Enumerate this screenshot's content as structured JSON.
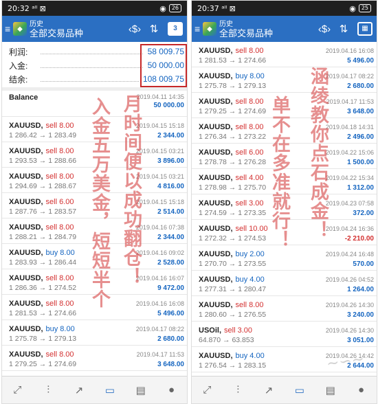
{
  "left": {
    "status": {
      "time": "20:32",
      "signal": "ᵃˡˡ ⊠",
      "battery": "26"
    },
    "header": {
      "title": "历史",
      "subtitle": "全部交易品种",
      "calendar_label": "3"
    },
    "summary": [
      {
        "label": "利润:",
        "value": "58 009.75"
      },
      {
        "label": "入金:",
        "value": "50 000.00"
      },
      {
        "label": "结余:",
        "value": "108 009.75"
      }
    ],
    "balance": {
      "label": "Balance",
      "date": "2019.04.11 14:35",
      "amount": "50 000.00"
    },
    "trades": [
      {
        "symbol": "XAUUSD,",
        "side": "sell 8.00",
        "type": "sell",
        "date": "2019.04.15 15:18",
        "prices": "1 286.42 → 1 283.49",
        "profit": "2 344.00"
      },
      {
        "symbol": "XAUUSD,",
        "side": "sell 8.00",
        "type": "sell",
        "date": "2019.04.15 03:21",
        "prices": "1 293.53 → 1 288.66",
        "profit": "3 896.00"
      },
      {
        "symbol": "XAUUSD,",
        "side": "sell 8.00",
        "type": "sell",
        "date": "2019.04.15 03:21",
        "prices": "1 294.69 → 1 288.67",
        "profit": "4 816.00"
      },
      {
        "symbol": "XAUUSD,",
        "side": "sell 6.00",
        "type": "sell",
        "date": "2019.04.15 15:18",
        "prices": "1 287.76 → 1 283.57",
        "profit": "2 514.00"
      },
      {
        "symbol": "XAUUSD,",
        "side": "sell 8.00",
        "type": "sell",
        "date": "2019.04.16 07:38",
        "prices": "1 288.21 → 1 284.79",
        "profit": "2 344.00"
      },
      {
        "symbol": "XAUUSD,",
        "side": "buy 8.00",
        "type": "buy",
        "date": "2019.04.16 09:02",
        "prices": "1 283.93 → 1 286.44",
        "profit": "2 528.00"
      },
      {
        "symbol": "XAUUSD,",
        "side": "sell 8.00",
        "type": "sell",
        "date": "2019.04.16 16:07",
        "prices": "1 286.36 → 1 274.52",
        "profit": "9 472.00"
      },
      {
        "symbol": "XAUUSD,",
        "side": "sell 8.00",
        "type": "sell",
        "date": "2019.04.16 16:08",
        "prices": "1 281.53 → 1 274.66",
        "profit": "5 496.00"
      },
      {
        "symbol": "XAUUSD,",
        "side": "buy 8.00",
        "type": "buy",
        "date": "2019.04.17 08:22",
        "prices": "1 275.78 → 1 279.13",
        "profit": "2 680.00"
      },
      {
        "symbol": "XAUUSD,",
        "side": "sell 8.00",
        "type": "sell",
        "date": "2019.04.17 11:53",
        "prices": "1 279.25 → 1 274.69",
        "profit": "3 648.00"
      }
    ],
    "overlay_col1": "入金五万美金，短短半个",
    "overlay_col2": "月时间便以成功翻仓！"
  },
  "right": {
    "status": {
      "time": "20:37",
      "signal": "ᵃˡˡ ⊠",
      "battery": "25"
    },
    "header": {
      "title": "历史",
      "subtitle": "全部交易品种"
    },
    "trades": [
      {
        "symbol": "XAUUSD,",
        "side": "sell 8.00",
        "type": "sell",
        "date": "2019.04.16 16:08",
        "prices": "1 281.53 → 1 274.66",
        "profit": "5 496.00"
      },
      {
        "symbol": "XAUUSD,",
        "side": "buy 8.00",
        "type": "buy",
        "date": "2019.04.17 08:22",
        "prices": "1 275.78 → 1 279.13",
        "profit": "2 680.00"
      },
      {
        "symbol": "XAUUSD,",
        "side": "sell 8.00",
        "type": "sell",
        "date": "2019.04.17 11:53",
        "prices": "1 279.25 → 1 274.69",
        "profit": "3 648.00"
      },
      {
        "symbol": "XAUUSD,",
        "side": "sell 8.00",
        "type": "sell",
        "date": "2019.04.18 14:31",
        "prices": "1 276.34 → 1 273.22",
        "profit": "2 496.00"
      },
      {
        "symbol": "XAUUSD,",
        "side": "sell 6.00",
        "type": "sell",
        "date": "2019.04.22 15:06",
        "prices": "1 278.78 → 1 276.28",
        "profit": "1 500.00"
      },
      {
        "symbol": "XAUUSD,",
        "side": "sell 4.00",
        "type": "sell",
        "date": "2019.04.22 15:34",
        "prices": "1 278.98 → 1 275.70",
        "profit": "1 312.00"
      },
      {
        "symbol": "XAUUSD,",
        "side": "sell 3.00",
        "type": "sell",
        "date": "2019.04.23 07:58",
        "prices": "1 274.59 → 1 273.35",
        "profit": "372.00"
      },
      {
        "symbol": "XAUUSD,",
        "side": "sell 10.00",
        "type": "sell",
        "date": "2019.04.24 16:36",
        "prices": "1 272.32 → 1 274.53",
        "profit": "-2 210.00"
      },
      {
        "symbol": "XAUUSD,",
        "side": "buy 2.00",
        "type": "buy",
        "date": "2019.04.24 16:48",
        "prices": "1 270.70 → 1 273.55",
        "profit": "570.00"
      },
      {
        "symbol": "XAUUSD,",
        "side": "buy 4.00",
        "type": "buy",
        "date": "2019.04.26 04:52",
        "prices": "1 277.31 → 1 280.47",
        "profit": "1 264.00"
      },
      {
        "symbol": "XAUUSD,",
        "side": "sell 8.00",
        "type": "sell",
        "date": "2019.04.26 14:30",
        "prices": "1 280.60 → 1 276.55",
        "profit": "3 240.00"
      },
      {
        "symbol": "USOil,",
        "side": "sell 3.00",
        "type": "sell",
        "date": "2019.04.26 14:30",
        "prices": "64.870 → 63.853",
        "profit": "3 051.00"
      },
      {
        "symbol": "XAUUSD,",
        "side": "buy 4.00",
        "type": "buy",
        "date": "2019.04.26 14:42",
        "prices": "1 276.54 → 1 283.15",
        "profit": "2 644.00"
      }
    ],
    "overlay_col1": "单不在多准就行！",
    "overlay_col2": "涵绫教你点石成金！"
  },
  "colors": {
    "appbar": "#2b6fc2",
    "profit": "#1565c0",
    "sell": "#d32f2f",
    "overlay": "#d64a4a"
  },
  "nav_icons": [
    "chart-up-icon",
    "candles-icon",
    "trend-icon",
    "inbox-icon",
    "news-icon",
    "chat-icon"
  ]
}
